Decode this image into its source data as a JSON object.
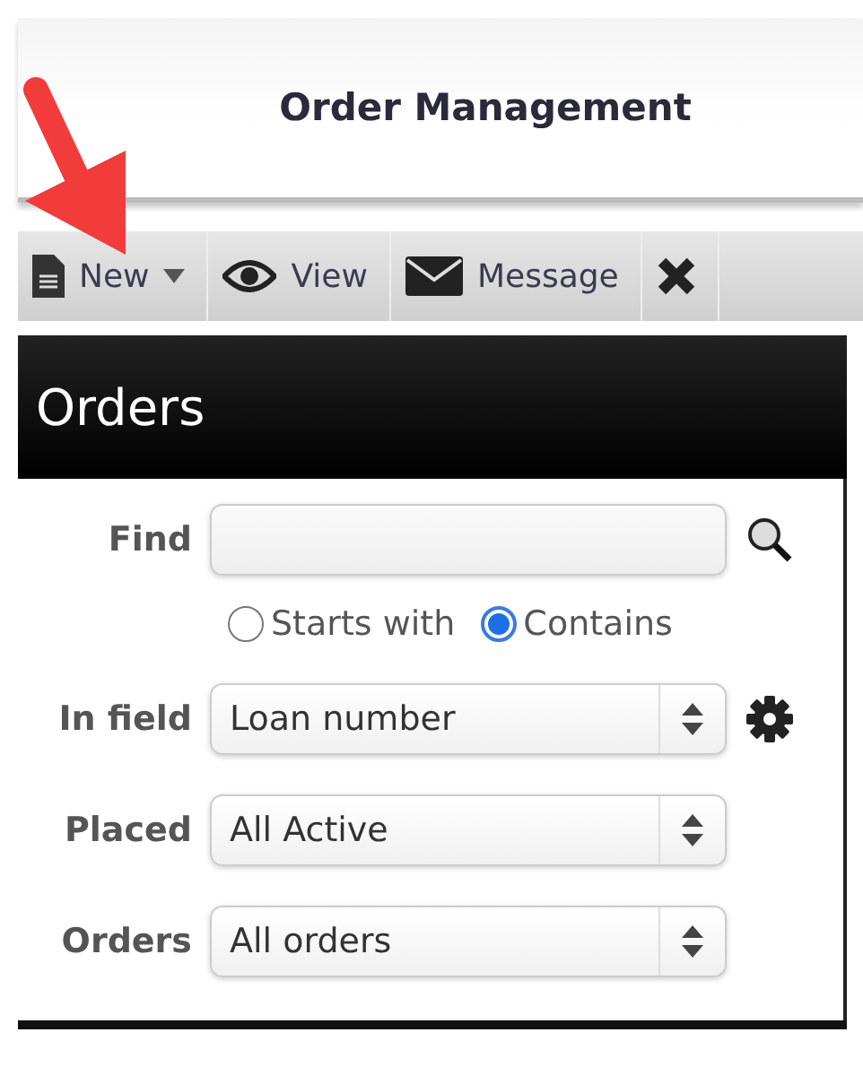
{
  "header": {
    "title": "Order Management"
  },
  "toolbar": [
    {
      "kind": "document",
      "label": "New",
      "dropdown": true
    },
    {
      "kind": "eye",
      "label": "View",
      "dropdown": false
    },
    {
      "kind": "envelope",
      "label": "Message",
      "dropdown": false
    },
    {
      "kind": "close",
      "dropdown": false
    }
  ],
  "panel": {
    "title": "Orders"
  },
  "find": {
    "label": "Find"
  },
  "match_options": [
    {
      "label": "Starts with",
      "selected": false
    },
    {
      "label": "Contains",
      "selected": true
    }
  ],
  "selects": [
    {
      "label": "In field",
      "value": "Loan number",
      "settings": true
    },
    {
      "label": "Placed",
      "value": "All Active",
      "settings": false
    },
    {
      "label": "Orders",
      "value": "All orders",
      "settings": false
    }
  ]
}
